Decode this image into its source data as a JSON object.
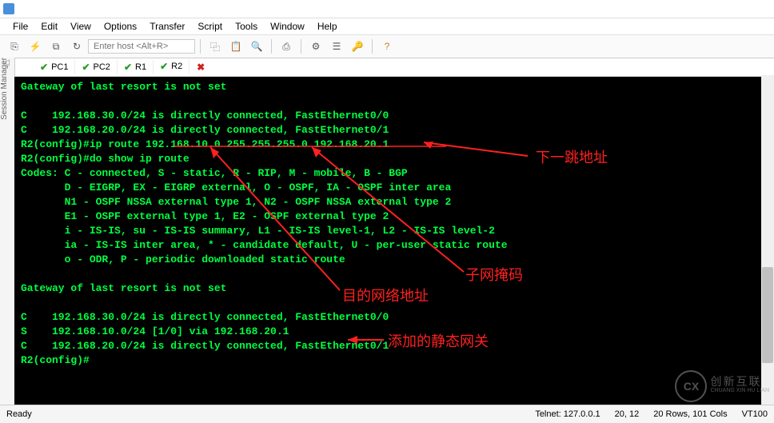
{
  "title": "",
  "menu": {
    "file": "File",
    "edit": "Edit",
    "view": "View",
    "options": "Options",
    "transfer": "Transfer",
    "script": "Script",
    "tools": "Tools",
    "window": "Window",
    "help": "Help"
  },
  "host_placeholder": "Enter host <Alt+R>",
  "tabs": [
    {
      "label": "PC1"
    },
    {
      "label": "PC2"
    },
    {
      "label": "R1"
    },
    {
      "label": "R2"
    }
  ],
  "session_mgr": "Session Manager",
  "terminal_lines": [
    "Gateway of last resort is not set",
    "",
    "C    192.168.30.0/24 is directly connected, FastEthernet0/0",
    "C    192.168.20.0/24 is directly connected, FastEthernet0/1",
    "R2(config)#ip route 192.168.10.0 255.255.255.0 192.168.20.1",
    "R2(config)#do show ip route",
    "Codes: C - connected, S - static, R - RIP, M - mobile, B - BGP",
    "       D - EIGRP, EX - EIGRP external, O - OSPF, IA - OSPF inter area",
    "       N1 - OSPF NSSA external type 1, N2 - OSPF NSSA external type 2",
    "       E1 - OSPF external type 1, E2 - OSPF external type 2",
    "       i - IS-IS, su - IS-IS summary, L1 - IS-IS level-1, L2 - IS-IS level-2",
    "       ia - IS-IS inter area, * - candidate default, U - per-user static route",
    "       o - ODR, P - periodic downloaded static route",
    "",
    "Gateway of last resort is not set",
    "",
    "C    192.168.30.0/24 is directly connected, FastEthernet0/0",
    "S    192.168.10.0/24 [1/0] via 192.168.20.1",
    "C    192.168.20.0/24 is directly connected, FastEthernet0/1",
    "R2(config)#"
  ],
  "annot": {
    "next_hop": "下一跳地址",
    "dest_net": "目的网络地址",
    "subnet": "子网掩码",
    "static_gw": "添加的静态网关"
  },
  "status": {
    "ready": "Ready",
    "telnet": "Telnet: 127.0.0.1",
    "pos": "20, 12",
    "size": "20 Rows, 101 Cols",
    "emul": "VT100"
  },
  "watermark": {
    "logo": "CX",
    "small": "CHUANG XIN HU LIAN",
    "main": "创新互联"
  }
}
